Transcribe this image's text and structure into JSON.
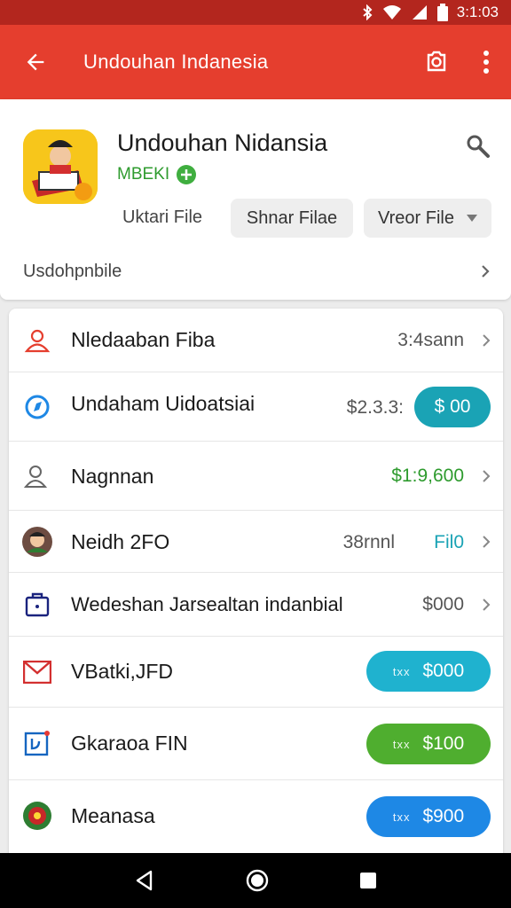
{
  "status_bar": {
    "time": "3:1:03",
    "bluetooth_icon": "bluetooth-icon",
    "wifi_icon": "wifi-icon",
    "signal_icon": "signal-icon",
    "battery_icon": "battery-icon"
  },
  "app_bar": {
    "title": "Undouhan Indanesia",
    "back_icon": "arrow-left-icon",
    "action_icon": "camera-settings-icon",
    "menu_icon": "more-vert-icon",
    "color": "#e53e2e"
  },
  "header": {
    "app_title": "Undouhan Nidansia",
    "developer": "MBEKI",
    "chip_text": "Uktari File",
    "chip_share": "Shnar Filae",
    "chip_view": "Vreor File",
    "more_link": "Usdohpnbile"
  },
  "rows": [
    {
      "label": "Nledaaban Fiba",
      "value": "3:4sann",
      "icon": "user-outline-icon"
    },
    {
      "label": "Undaham Uidoatsiai",
      "value": "$2.3.3:",
      "button": "$ 00",
      "icon": "compass-icon"
    },
    {
      "label": "Nagnnan",
      "value": "$1:9,600",
      "icon": "person-icon"
    },
    {
      "label": "Neidh 2FO",
      "value": "38rnnl",
      "value2": "Fil0",
      "icon": "avatar-icon"
    },
    {
      "label": "Wedeshan Jarsealtan indanbial",
      "value": "$000",
      "icon": "bag-icon"
    },
    {
      "label": "VBatki,JFD",
      "button_tag": "txx",
      "button": "$000",
      "icon": "mail-icon"
    },
    {
      "label": "Gkaraoa FIN",
      "button_tag": "txx",
      "button": "$100",
      "icon": "edit-box-icon"
    },
    {
      "label": "Meanasa",
      "button_tag": "txx",
      "button": "$900",
      "icon": "emblem-icon"
    }
  ],
  "colors": {
    "teal": "#1aa3b5",
    "cyan": "#1fb2cf",
    "green": "#4fae2f",
    "blue": "#1e88e5",
    "green_text": "#2e9b2e"
  }
}
